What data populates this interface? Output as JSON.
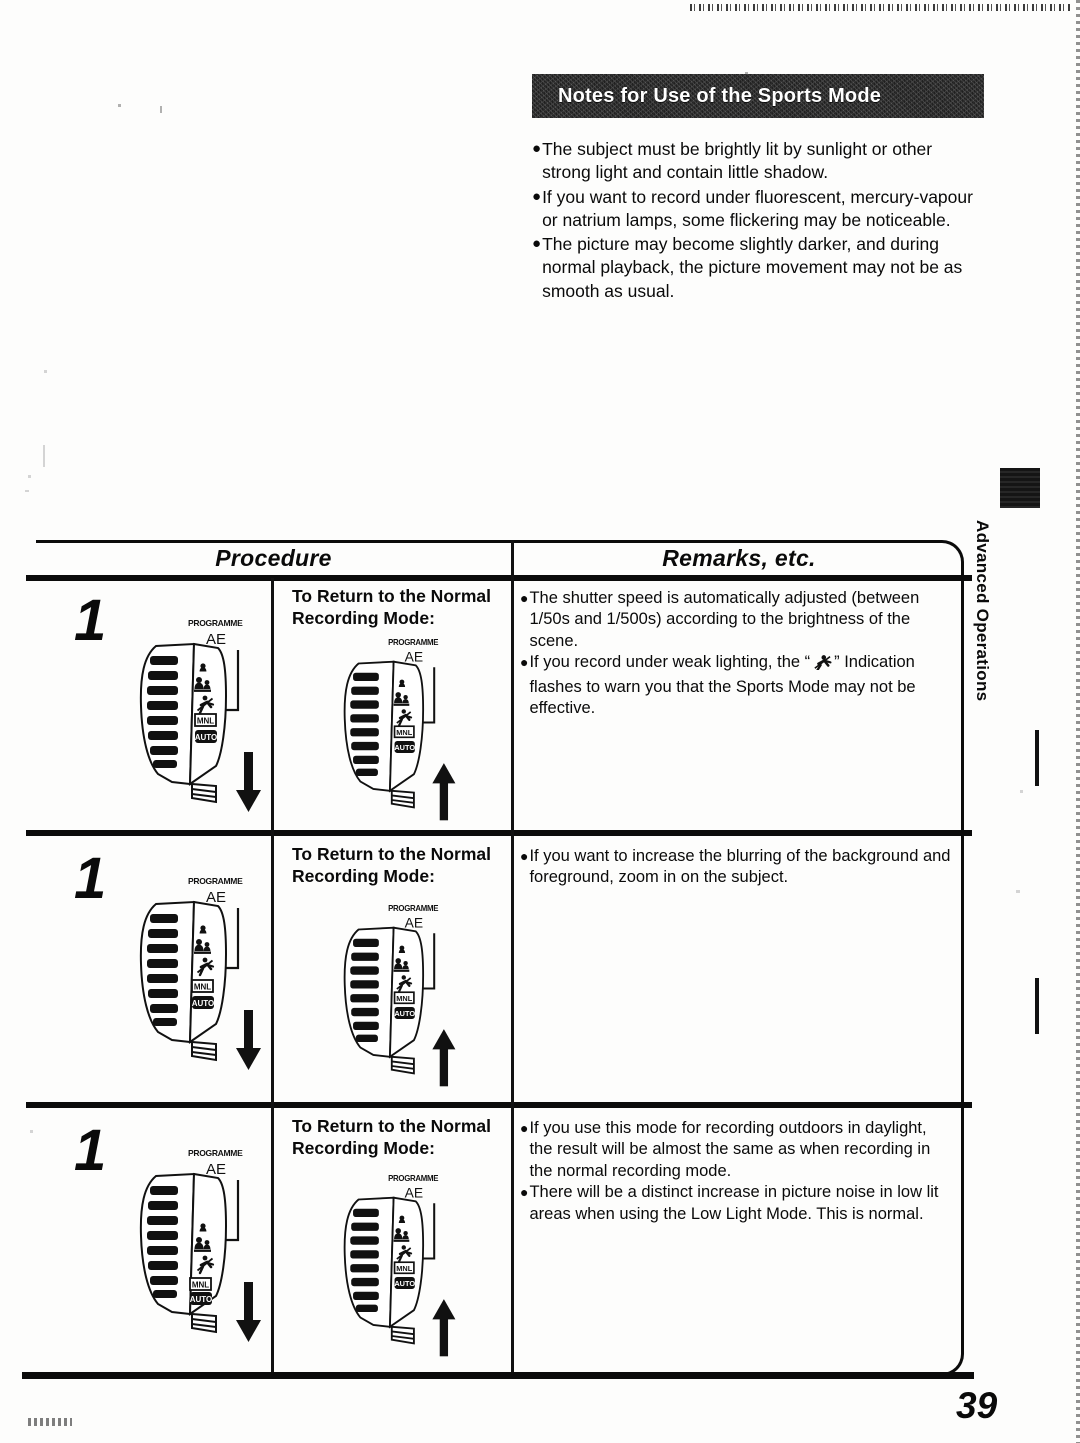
{
  "notes": {
    "heading": "Notes for Use of the Sports Mode",
    "bullets": [
      "The subject must be brightly lit by sunlight or other strong light and contain little shadow.",
      "If you want to record under fluorescent, mercury-vapour or natrium lamps, some flickering may be noticeable.",
      "The picture may become slightly darker, and during normal playback, the picture movement may not be as smooth as usual."
    ],
    "bullet_glyph": "●"
  },
  "side_tab": {
    "label": "Advanced Operations"
  },
  "table": {
    "headers": {
      "procedure": "Procedure",
      "remarks": "Remarks, etc."
    },
    "rows": [
      {
        "step_number": "1",
        "return_title": "To Return to the Normal Recording Mode:",
        "remarks": [
          "The shutter speed is automatically adjusted (between 1/50s and 1/500s) according to the brightness of the scene.",
          "If you record under weak lighting, the “ ” Indication flashes to warn you that the Sports Mode may not be effective."
        ],
        "remark_2_prefix": "If you record under weak lighting, the “",
        "remark_2_suffix": "” Indication flashes to warn you that the Sports Mode may not be effective."
      },
      {
        "step_number": "1",
        "return_title": "To Return to the Normal Recording Mode:",
        "remarks": [
          "If you want to increase the blurring of the background and foreground, zoom in on the subject."
        ]
      },
      {
        "step_number": "1",
        "return_title": "To Return to the Normal Recording Mode:",
        "remarks": [
          "If you use this mode for recording outdoors in daylight, the result will be almost the same as when recording in the normal recording mode.",
          "There will be a distinct increase in picture noise in low lit areas when using the Low Light Mode. This is normal."
        ]
      }
    ],
    "bullet_glyph": "●"
  },
  "dial": {
    "label_top": "PROGRAMME",
    "label_ae": "AE",
    "button_manual": "MNL",
    "button_auto": "AUTO",
    "icons": [
      "portrait-icon",
      "group-icon",
      "sports-icon"
    ]
  },
  "page_number": "39"
}
